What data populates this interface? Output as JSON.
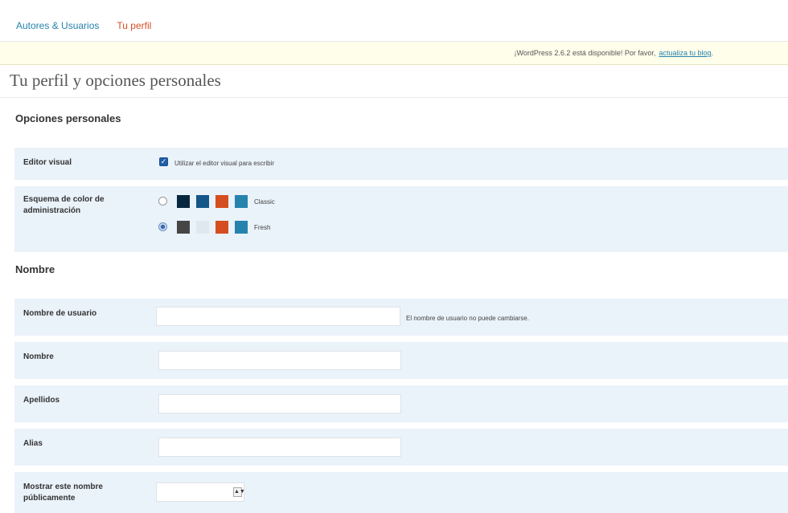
{
  "nav": {
    "items": [
      {
        "label": "Autores & Usuarios"
      },
      {
        "label": "Tu perfil"
      }
    ]
  },
  "notice": {
    "text": "¡WordPress 2.6.2 está disponible! Por favor,",
    "link": "actualiza tu blog",
    "end": "."
  },
  "page_title": "Tu perfil y opciones personales",
  "personal": {
    "heading": "Opciones personales",
    "visual_editor": {
      "label": "Editor visual",
      "checkbox_text": "Utilizar el editor visual para escribir",
      "checked": true
    },
    "color_scheme": {
      "label_line1": "Esquema de color de",
      "label_line2": "administración",
      "options": [
        {
          "name": "Classic",
          "selected": false,
          "colors": [
            "#07273e",
            "#14568a",
            "#d54e21",
            "#2683ae"
          ]
        },
        {
          "name": "Fresh",
          "selected": true,
          "colors": [
            "#464646",
            "#e5e5e5",
            "#d54e21",
            "#2683ae"
          ]
        }
      ]
    }
  },
  "name_section": {
    "heading": "Nombre",
    "username": {
      "label": "Nombre de usuario",
      "value": "",
      "note": "El nombre de usuario no puede cambiarse."
    },
    "first_name": {
      "label": "Nombre",
      "value": ""
    },
    "last_name": {
      "label": "Apellidos",
      "value": ""
    },
    "nickname": {
      "label": "Alias",
      "value": ""
    },
    "display_name": {
      "label_line1": "Mostrar este nombre",
      "label_line2": "públicamente",
      "value": ""
    }
  },
  "colors": {
    "link": "#2583ad",
    "current": "#d54e21",
    "row_bg": "#eaf2fa",
    "notice_bg": "#fffeeb"
  }
}
